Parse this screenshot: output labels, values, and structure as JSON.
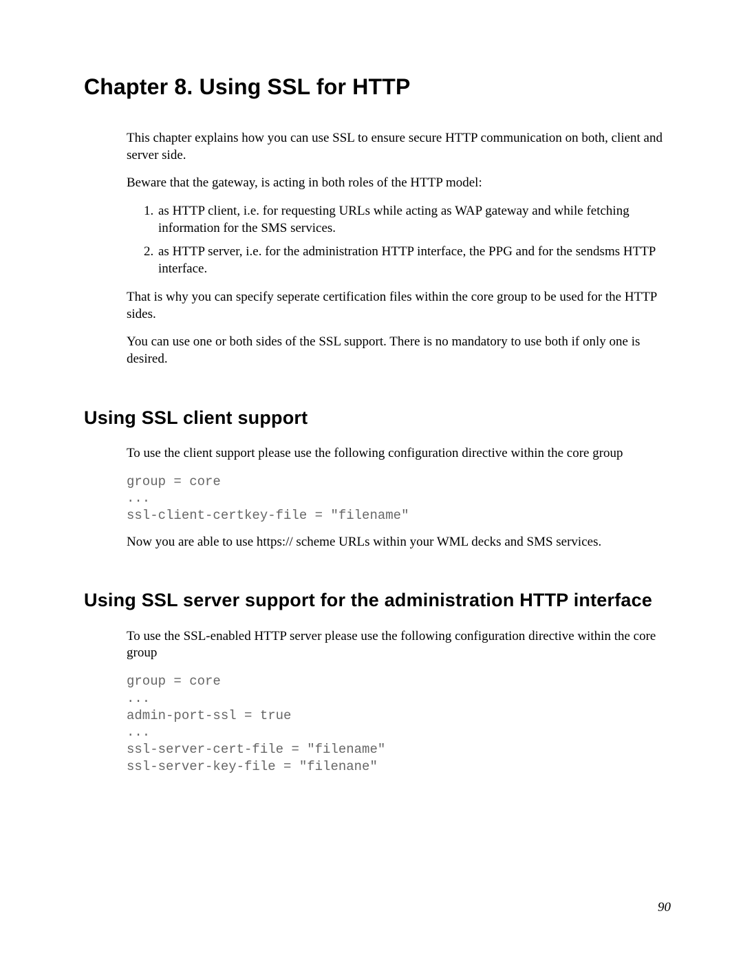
{
  "chapter": {
    "title": "Chapter 8. Using SSL for HTTP"
  },
  "intro": {
    "p1": "This chapter explains how you can use SSL to ensure secure HTTP communication on both, client and server side.",
    "p2": "Beware that the gateway, is acting in both roles of the HTTP model:",
    "li1": "as HTTP client, i.e. for requesting URLs while acting as WAP gateway and while fetching information for the SMS services.",
    "li2": "as HTTP server, i.e. for the administration HTTP interface, the PPG and for the sendsms HTTP interface.",
    "p3": "That is why you can specify seperate certification files within the core group to be used for the HTTP sides.",
    "p4": "You can use one or both sides of the SSL support. There is no mandatory to use both if only one is desired."
  },
  "section_client": {
    "title": "Using SSL client support",
    "p1": "To use the client support please use the following configuration directive within the core group",
    "code": "group = core\n...\nssl-client-certkey-file = \"filename\"",
    "p2": "Now you are able to use https:// scheme URLs within your WML decks and SMS services."
  },
  "section_server": {
    "title": "Using SSL server support for the administration HTTP interface",
    "p1": "To use the SSL-enabled HTTP server please use the following configuration directive within the core group",
    "code": "group = core\n...\nadmin-port-ssl = true\n...\nssl-server-cert-file = \"filename\"\nssl-server-key-file = \"filenane\""
  },
  "page_number": "90"
}
